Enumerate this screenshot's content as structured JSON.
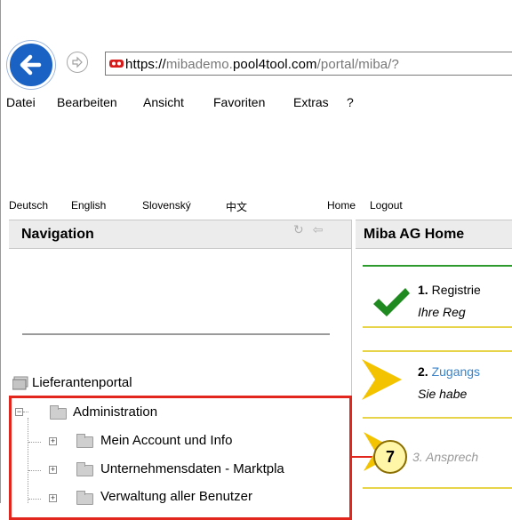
{
  "browser": {
    "url_scheme": "https://",
    "url_sub": "mibademo.",
    "url_domain": "pool4tool.com",
    "url_path": "/portal/miba/?",
    "menu": [
      "Datei",
      "Bearbeiten",
      "Ansicht",
      "Favoriten",
      "Extras",
      "?"
    ]
  },
  "header_links": {
    "languages": [
      "Deutsch",
      "English",
      "Slovenský",
      "中文"
    ],
    "home": "Home",
    "logout": "Logout"
  },
  "navigation": {
    "title": "Navigation",
    "root": "Lieferantenportal",
    "tree": [
      {
        "label": "Administration"
      },
      {
        "label": "Mein Account und Info"
      },
      {
        "label": "Unternehmensdaten - Marktpla"
      },
      {
        "label": "Verwaltung aller Benutzer"
      }
    ]
  },
  "main": {
    "title": "Miba AG Home",
    "steps": [
      {
        "num": "1.",
        "title": "Registrie",
        "sub": "Ihre Reg"
      },
      {
        "num": "2.",
        "title": "Zugangs",
        "sub": "Sie habe"
      },
      {
        "num": "",
        "title": "3. Ansprech",
        "sub": ""
      }
    ]
  },
  "callout": {
    "number": "7"
  },
  "colors": {
    "highlight": "#e2261d",
    "back_button": "#1a63c4",
    "success": "#1f8a1f",
    "arrow": "#f4c300",
    "link": "#3a83c8"
  }
}
